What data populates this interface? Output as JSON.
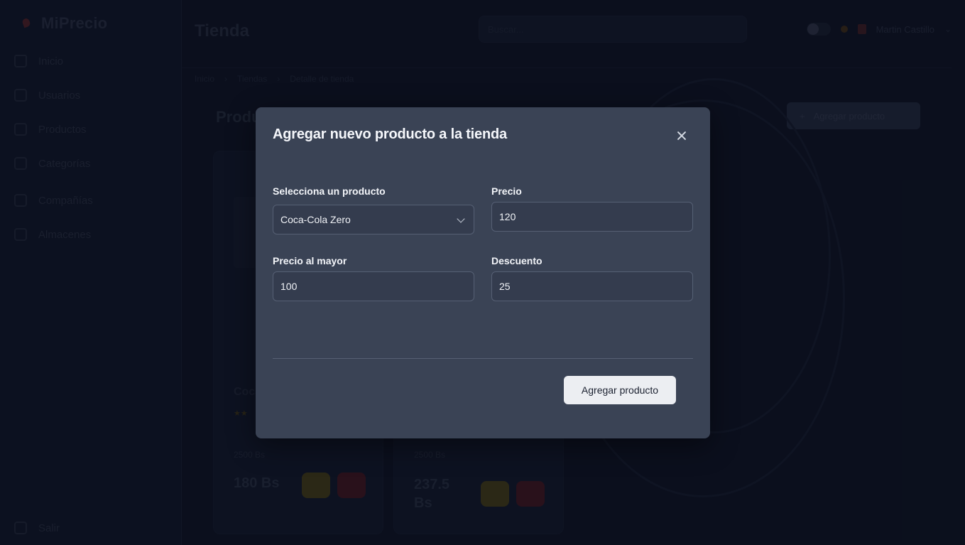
{
  "app": {
    "brand": "MiPrecio",
    "page_title": "Tienda",
    "search_placeholder": "Buscar...",
    "user_name": "Martin Castillo",
    "sidebar": {
      "items": [
        {
          "label": "Inicio",
          "icon": "home-icon"
        },
        {
          "label": "Usuarios",
          "icon": "users-icon"
        },
        {
          "label": "Productos",
          "icon": "box-icon"
        },
        {
          "label": "Categorías",
          "icon": "tag-icon"
        },
        {
          "label": "Compañías",
          "icon": "building-icon"
        },
        {
          "label": "Almacenes",
          "icon": "warehouse-icon"
        }
      ],
      "logout": "Salir"
    },
    "breadcrumb": [
      "Inicio",
      "Tiendas",
      "Detalle de tienda"
    ],
    "section_title": "Productos",
    "add_button": "Agregar producto",
    "cards": [
      {
        "name": "Coca-Cola",
        "meta": "2500 Bs",
        "price": "180 Bs"
      },
      {
        "name": "",
        "meta": "2500 Bs",
        "price": "237.5 Bs"
      }
    ]
  },
  "modal": {
    "title": "Agregar nuevo producto a la tienda",
    "fields": {
      "product": {
        "label": "Selecciona un producto",
        "value": "Coca-Cola Zero"
      },
      "price": {
        "label": "Precio",
        "value": "120"
      },
      "wholesale_price": {
        "label": "Precio al mayor",
        "value": "100"
      },
      "discount": {
        "label": "Descuento",
        "value": "25"
      }
    },
    "submit_label": "Agregar producto"
  },
  "colors": {
    "modal_bg": "#3a4355",
    "page_bg": "#0e1322",
    "input_border": "#566074",
    "primary_button": "#eceef2"
  }
}
